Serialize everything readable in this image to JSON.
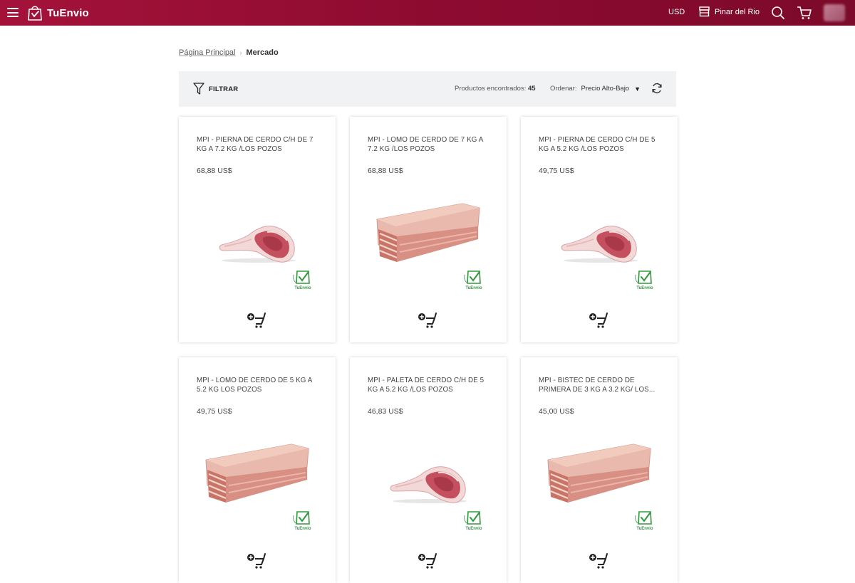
{
  "header": {
    "brand": "TuEnvio",
    "currency": "USD",
    "store": "Pinar del Rio"
  },
  "breadcrumb": {
    "home": "Página Principal",
    "current": "Mercado"
  },
  "toolbar": {
    "filter_label": "FILTRAR",
    "found_label": "Productos encontrados:",
    "found_count": "45",
    "sort_label": "Ordenar:",
    "sort_value": "Precio Alto-Bajo"
  },
  "products": [
    {
      "title": "MPI - PIERNA DE CERDO C/H DE 7 KG A 7.2 KG /LOS POZOS",
      "price": "68,88 US$",
      "image": "pork-leg"
    },
    {
      "title": "MPI - LOMO DE CERDO DE 7 KG A 7.2 KG /LOS POZOS",
      "price": "68,88 US$",
      "image": "pork-loin"
    },
    {
      "title": "MPI - PIERNA DE CERDO C/H DE 5 KG A 5.2 KG /LOS POZOS",
      "price": "49,75 US$",
      "image": "pork-leg"
    },
    {
      "title": "MPI - LOMO DE CERDO DE 5 KG A 5.2 KG LOS POZOS",
      "price": "49,75 US$",
      "image": "pork-loin"
    },
    {
      "title": "MPI - PALETA DE CERDO C/H DE 5 KG A 5.2 KG /LOS POZOS",
      "price": "46,83 US$",
      "image": "pork-leg"
    },
    {
      "title": "MPI - BISTEC DE CERDO DE PRIMERA DE 3 KG A 3.2 KG/ LOS...",
      "price": "45,00 US$",
      "image": "pork-loin"
    }
  ],
  "badge": {
    "text": "TuEnvio",
    "color": "#2e9a3c"
  },
  "colors": {
    "brand": "#96103a",
    "toolbar_bg": "#f0f2f3"
  }
}
